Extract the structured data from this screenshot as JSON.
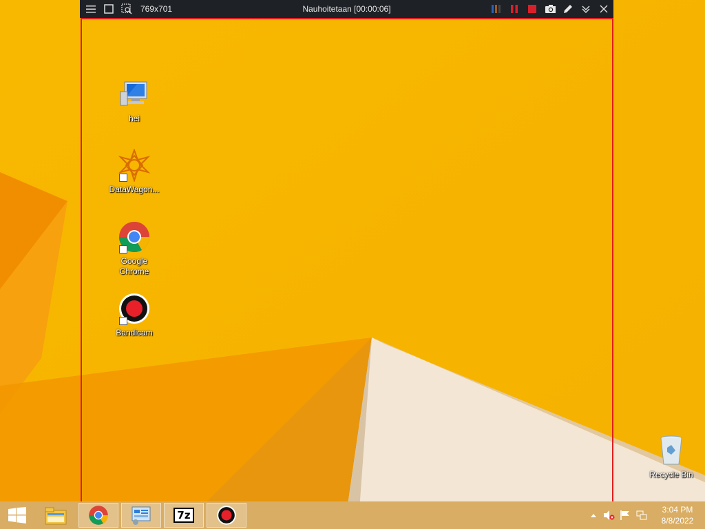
{
  "bandicam": {
    "menu_icon": "hamburger-icon",
    "window_mode_icon": "square-icon",
    "region_icon": "region-select-icon",
    "size_label": "769x701",
    "status_title": "Nauhoitetaan [00:00:06]",
    "buttons": [
      "pause-icon",
      "stop-icon",
      "camera-icon",
      "pencil-icon",
      "collapse-icon",
      "close-icon"
    ],
    "accent_color": "#e21d1d"
  },
  "desktop": {
    "icons": [
      {
        "label": "hei",
        "icon": "computer-icon"
      },
      {
        "label": "DataWagon...",
        "icon": "datawagon-icon"
      },
      {
        "label": "Google Chrome",
        "icon": "chrome-icon"
      },
      {
        "label": "Bandicam",
        "icon": "bandicam-icon"
      }
    ],
    "recycle_bin": {
      "label": "Recycle Bin",
      "icon": "recycle-bin-icon"
    }
  },
  "taskbar": {
    "start": "windows-start-icon",
    "pinned": [
      "file-explorer-icon",
      "chrome-icon",
      "control-panel-icon",
      "7zip-icon",
      "bandicam-icon"
    ],
    "seven_zip_label": "7z",
    "tray": [
      "show-hidden-icon",
      "volume-muted-icon",
      "action-center-flag-icon",
      "network-icon"
    ],
    "time": "3:04 PM",
    "date": "8/8/2022"
  }
}
